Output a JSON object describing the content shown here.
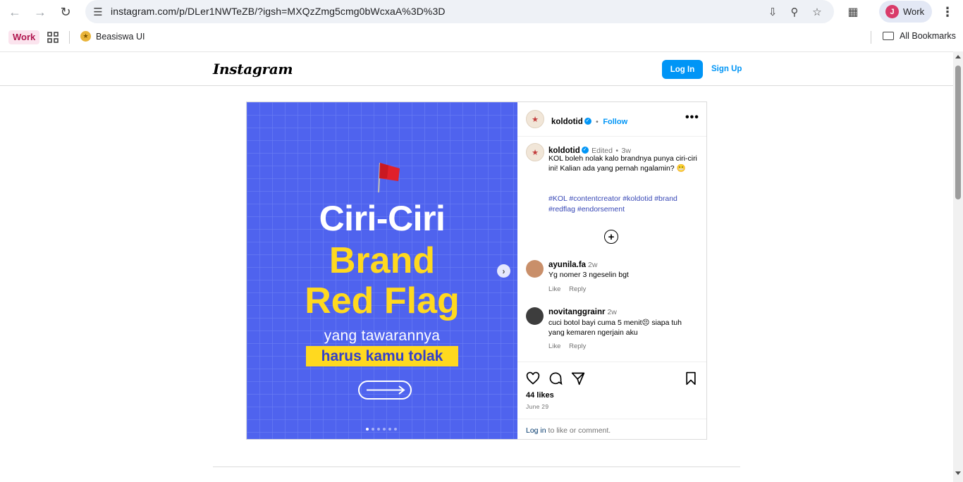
{
  "browser": {
    "url": "instagram.com/p/DLer1NWTeZB/?igsh=MXQzZmg5cmg0bWcxaA%3D%3D",
    "profile_initial": "J",
    "profile_name": "Work",
    "bookmarks": {
      "work_label": "Work",
      "item_label": "Beasiswa UI",
      "all_label": "All Bookmarks"
    }
  },
  "header": {
    "logo": "Instagram",
    "login_label": "Log In",
    "signup_label": "Sign Up"
  },
  "media": {
    "line1": "Ciri-Ciri",
    "line2": "Brand",
    "line3": "Red Flag",
    "line4": "yang tawarannya",
    "line5": "harus kamu tolak",
    "bg_color": "#4f63ee",
    "accent_color": "#ffd91f",
    "slide_count": 6,
    "active_slide": 1
  },
  "post": {
    "username": "koldotid",
    "follow_label": "Follow",
    "caption": {
      "username": "koldotid",
      "edited": "Edited",
      "time": "3w",
      "text": "KOL boleh nolak kalo brandnya punya ciri-ciri ini! Kalian ada yang pernah ngalamin? 😬",
      "hashtags": "#KOL #contentcreator #koldotid #brand #redflag #endorsement"
    },
    "comments": [
      {
        "username": "ayunila.fa",
        "time": "2w",
        "text": "Yg nomer 3 ngeselin bgt",
        "like_label": "Like",
        "reply_label": "Reply"
      },
      {
        "username": "novitanggrainr",
        "time": "2w",
        "text": "cuci botol bayi cuma 5 menit😣 siapa tuh yang kemaren ngerjain aku",
        "like_label": "Like",
        "reply_label": "Reply"
      }
    ],
    "likes": "44 likes",
    "date": "June 29",
    "login_link": "Log in",
    "login_suffix": " to like or comment."
  }
}
